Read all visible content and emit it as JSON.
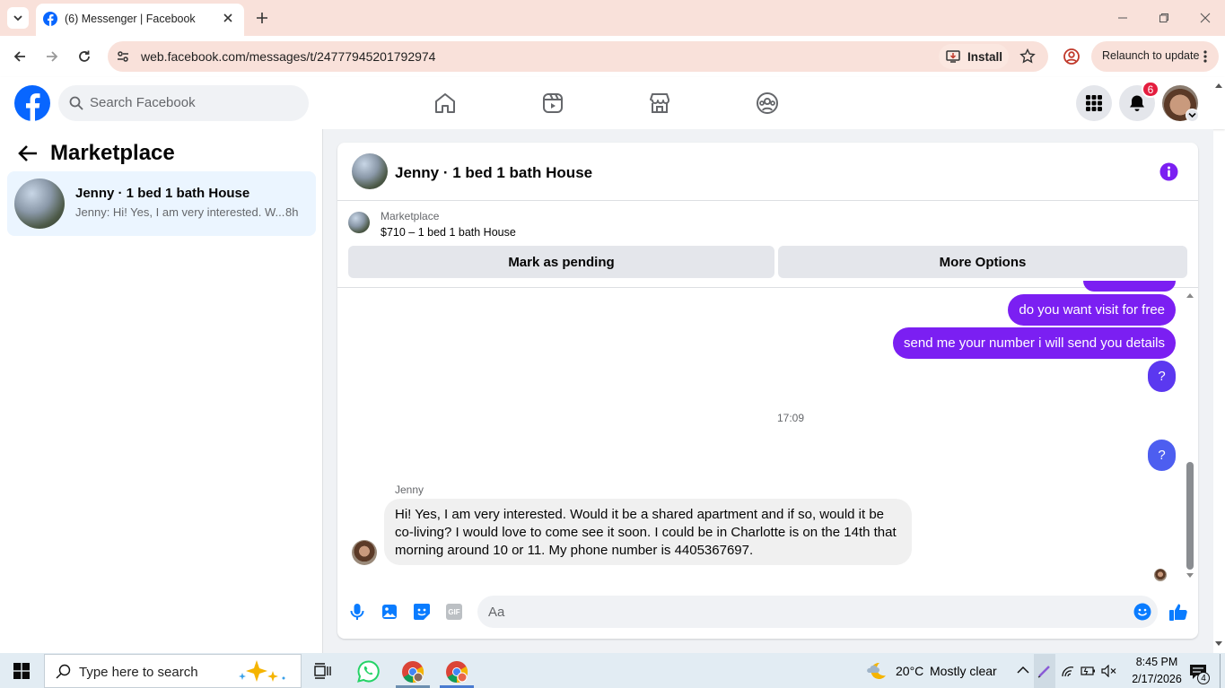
{
  "browser": {
    "tab_title": "(6) Messenger | Facebook",
    "url": "web.facebook.com/messages/t/24777945201792974",
    "install_label": "Install",
    "relaunch_label": "Relaunch to update"
  },
  "fb_header": {
    "search_placeholder": "Search Facebook",
    "notification_count": "6"
  },
  "sidebar": {
    "title": "Marketplace",
    "conversation": {
      "name": "Jenny · 1 bed 1 bath House",
      "preview": "Jenny: Hi! Yes, I am very interested. W...",
      "time": "8h"
    }
  },
  "chat": {
    "title": "Jenny · 1 bed 1 bath House",
    "listing": {
      "source": "Marketplace",
      "price_title": "$710 – 1 bed 1 bath House"
    },
    "pending_button": "Mark as pending",
    "options_button": "More Options",
    "messages": [
      {
        "from": "me",
        "text": "do you want visit for free"
      },
      {
        "from": "me",
        "text": "send me your number i will send you details"
      },
      {
        "from": "me",
        "text": "?"
      },
      {
        "from": "system",
        "text": "17:09"
      },
      {
        "from": "me",
        "text": "?"
      },
      {
        "from": "Jenny",
        "sender_label": "Jenny",
        "text": "Hi! Yes, I am very interested. Would it be a shared apartment and if so, would it be co-living? I would love to come see it soon. I could be in Charlotte is on the 14th that morning around 10 or 11. My phone number is 4405367697."
      }
    ],
    "composer_placeholder": "Aa"
  },
  "taskbar": {
    "search_placeholder": "Type here to search",
    "weather_temp": "20°C",
    "weather_text": "Mostly clear",
    "time": "8:45 PM",
    "date": "2/17/2026",
    "notif_count": "4"
  },
  "colors": {
    "fb_blue": "#0866ff",
    "messenger_purple": "#7b1ff2",
    "accent_blue": "#0a7cff",
    "badge_red": "#e41e3f",
    "chrome_tab_bg": "#f9e1da"
  }
}
